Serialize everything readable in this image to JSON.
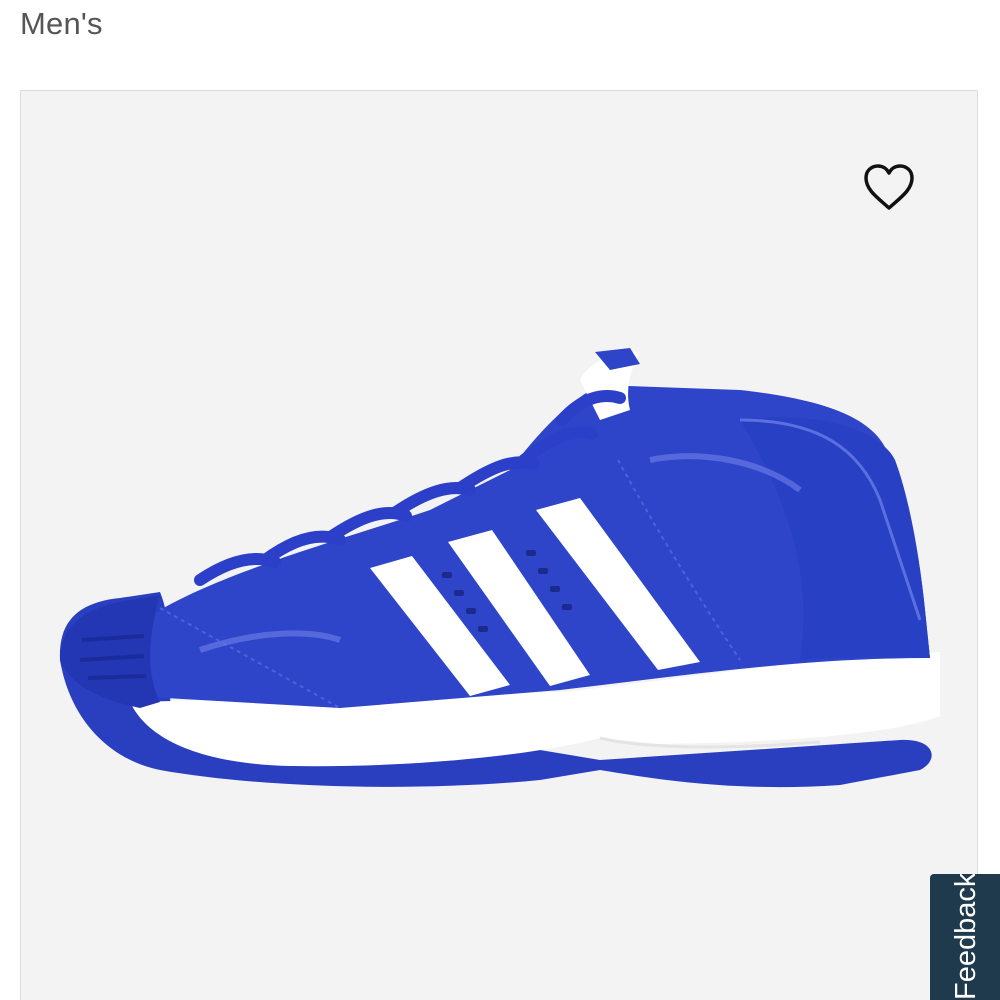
{
  "header": {
    "category": "Men's"
  },
  "product": {
    "image": {
      "subject": "blue-basketball-shoe",
      "colors": {
        "body": "#2e45c9",
        "body_dark": "#1c2fa6",
        "stripes": "#ffffff",
        "sole": "#ffffff",
        "outsole": "#2a3fc0",
        "background": "#f3f3f3"
      }
    },
    "wishlist_icon": "heart-outline-icon"
  },
  "feedback": {
    "label": "Feedback",
    "color": "#1f3a4d"
  }
}
